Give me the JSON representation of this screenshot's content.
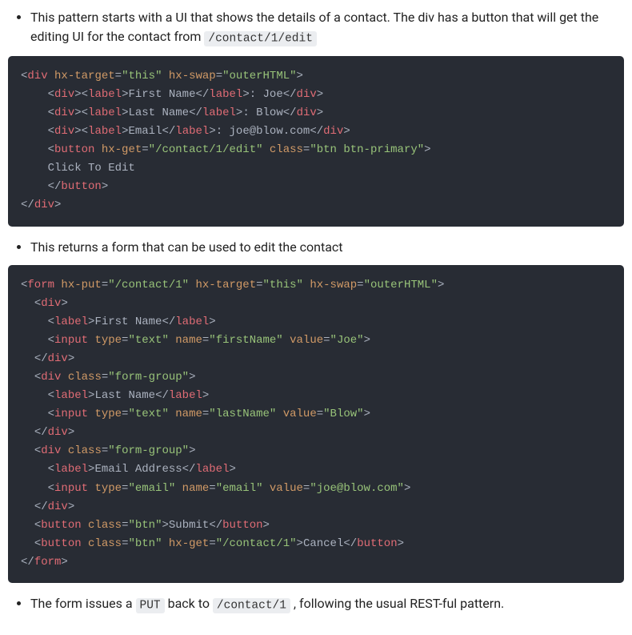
{
  "bullets": {
    "intro_a": "This pattern starts with a UI that shows the details of a contact. The div has a button that will get the editing UI for the contact from ",
    "intro_code": "/contact/1/edit",
    "mid": "This returns a form that can be used to edit the contact",
    "final_a": "The form issues a ",
    "final_code1": "PUT",
    "final_b": " back to ",
    "final_code2": "/contact/1",
    "final_c": ", following the usual REST-ful pattern."
  },
  "code1": {
    "div_hx_target": "\"this\"",
    "div_hx_swap": "\"outerHTML\"",
    "label_first": "First Name",
    "val_first": ": Joe",
    "label_last": "Last Name",
    "val_last": ": Blow",
    "label_email": "Email",
    "val_email": ": joe@blow.com",
    "btn_hx_get": "\"/contact/1/edit\"",
    "btn_class": "\"btn btn-primary\"",
    "btn_text": "    Click To Edit"
  },
  "code2": {
    "form_hx_put": "\"/contact/1\"",
    "form_hx_target": "\"this\"",
    "form_hx_swap": "\"outerHTML\"",
    "label_first": "First Name",
    "inp1_type": "\"text\"",
    "inp1_name": "\"firstName\"",
    "inp1_value": "\"Joe\"",
    "div2_class": "\"form-group\"",
    "label_last": "Last Name",
    "inp2_type": "\"text\"",
    "inp2_name": "\"lastName\"",
    "inp2_value": "\"Blow\"",
    "div3_class": "\"form-group\"",
    "label_email": "Email Address",
    "inp3_type": "\"email\"",
    "inp3_name": "\"email\"",
    "inp3_value": "\"joe@blow.com\"",
    "btn1_class": "\"btn\"",
    "btn1_text": "Submit",
    "btn2_class": "\"btn\"",
    "btn2_hx_get": "\"/contact/1\"",
    "btn2_text": "Cancel"
  }
}
